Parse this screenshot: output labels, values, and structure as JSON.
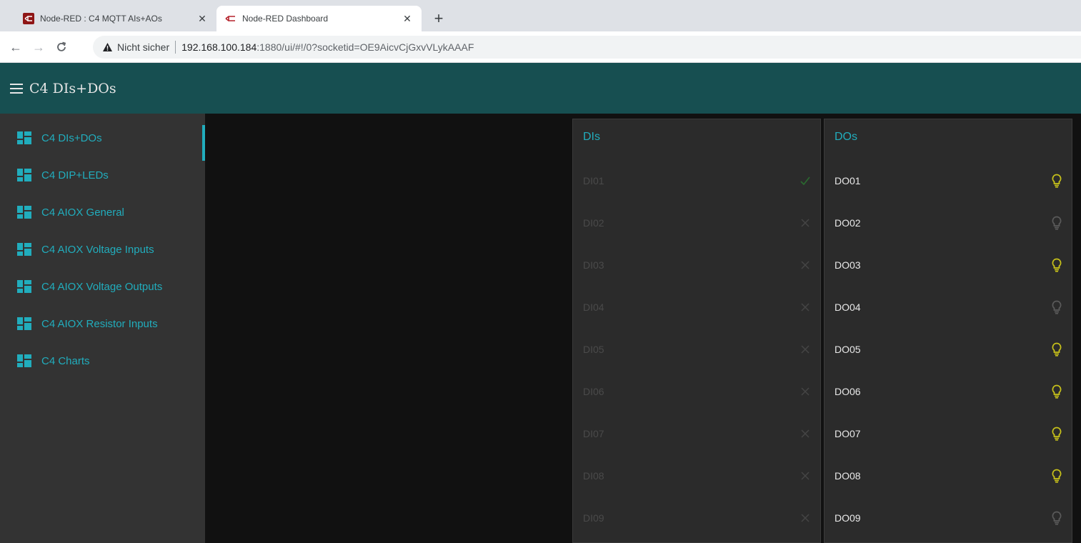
{
  "browser": {
    "tabs": [
      {
        "title": "Node-RED : C4 MQTT AIs+AOs",
        "active": false
      },
      {
        "title": "Node-RED Dashboard",
        "active": true
      }
    ],
    "security_label": "Nicht sicher",
    "url_host": "192.168.100.184",
    "url_rest": ":1880/ui/#!/0?socketid=OE9AicvCjGxvVLykAAAF"
  },
  "appbar": {
    "title": "C4 DIs+DOs"
  },
  "sidebar": {
    "items": [
      {
        "label": "C4 DIs+DOs",
        "active": true
      },
      {
        "label": "C4 DIP+LEDs",
        "active": false
      },
      {
        "label": "C4 AIOX General",
        "active": false
      },
      {
        "label": "C4 AIOX Voltage Inputs",
        "active": false
      },
      {
        "label": "C4 AIOX Voltage Outputs",
        "active": false
      },
      {
        "label": "C4 AIOX Resistor Inputs",
        "active": false
      },
      {
        "label": "C4 Charts",
        "active": false
      }
    ]
  },
  "dis": {
    "title": "DIs",
    "rows": [
      {
        "label": "DI01",
        "state": "check-icon"
      },
      {
        "label": "DI02",
        "state": "cross-icon"
      },
      {
        "label": "DI03",
        "state": "cross-icon"
      },
      {
        "label": "DI04",
        "state": "cross-icon"
      },
      {
        "label": "DI05",
        "state": "cross-icon"
      },
      {
        "label": "DI06",
        "state": "cross-icon"
      },
      {
        "label": "DI07",
        "state": "cross-icon"
      },
      {
        "label": "DI08",
        "state": "cross-icon"
      },
      {
        "label": "DI09",
        "state": "cross-icon"
      }
    ]
  },
  "dos": {
    "title": "DOs",
    "rows": [
      {
        "label": "DO01",
        "on": true
      },
      {
        "label": "DO02",
        "on": false
      },
      {
        "label": "DO03",
        "on": true
      },
      {
        "label": "DO04",
        "on": false
      },
      {
        "label": "DO05",
        "on": true
      },
      {
        "label": "DO06",
        "on": true
      },
      {
        "label": "DO07",
        "on": true
      },
      {
        "label": "DO08",
        "on": true
      },
      {
        "label": "DO09",
        "on": false
      }
    ]
  },
  "colors": {
    "accent": "#21adbd",
    "appbar": "#174f51",
    "bulb_on": "#c8c21a",
    "bulb_off": "#5a5a5a",
    "check": "#2a6a2f",
    "cross": "#454545"
  }
}
